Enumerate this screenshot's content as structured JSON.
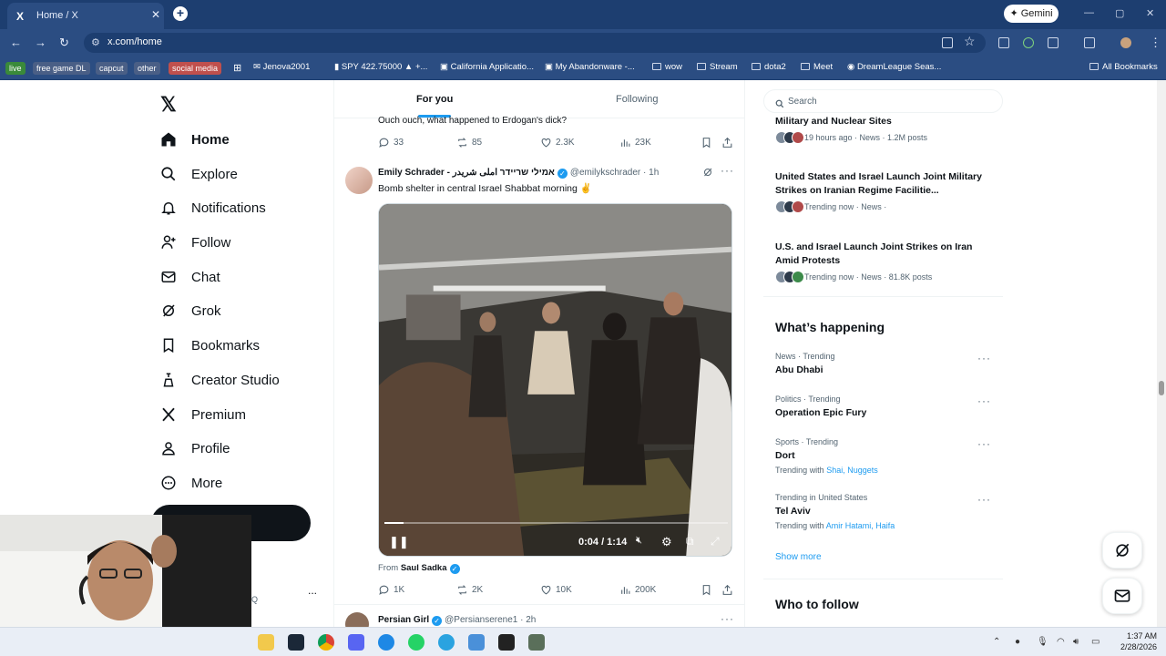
{
  "browser": {
    "tab_title": "Home / X",
    "tab_favicon": "X",
    "url": "x.com/home",
    "gemini_label": "Gemini",
    "bookmarks": [
      "live",
      "free game DL",
      "capcut",
      "other",
      "social media",
      "Jenova2001",
      "SPY 422.75000 ▲ +...",
      "California Applicatio...",
      "My Abandonware -...",
      "wow",
      "Stream",
      "dota2",
      "Meet",
      "DreamLeague Seas...",
      "All Bookmarks"
    ],
    "pill_colors": {
      "live": "#3a8a3a",
      "social": "#c0504d",
      "other_pills": "#4a5f86"
    }
  },
  "nav": {
    "items": [
      {
        "label": "Home",
        "icon": "home-icon"
      },
      {
        "label": "Explore",
        "icon": "search-icon"
      },
      {
        "label": "Notifications",
        "icon": "bell-icon"
      },
      {
        "label": "Follow",
        "icon": "person-add-icon"
      },
      {
        "label": "Chat",
        "icon": "envelope-icon"
      },
      {
        "label": "Grok",
        "icon": "grok-icon"
      },
      {
        "label": "Bookmarks",
        "icon": "bookmark-icon"
      },
      {
        "label": "Creator Studio",
        "icon": "creator-studio-icon"
      },
      {
        "label": "Premium",
        "icon": "x-logo-icon"
      },
      {
        "label": "Profile",
        "icon": "person-icon"
      },
      {
        "label": "More",
        "icon": "more-circle-icon"
      }
    ],
    "side_dots": "...",
    "side_letter": "Q"
  },
  "feed": {
    "tabs": [
      "For you",
      "Following"
    ],
    "prev_post_text": "Ouch ouch, what happened to Erdogan's dick?",
    "prev_actions": {
      "replies": "33",
      "reposts": "85",
      "likes": "2.3K",
      "views": "23K"
    },
    "post": {
      "author": "Emily Schrader - אמילי שריידר املی شریدر",
      "handle": "@emilykschrader",
      "time": "· 1h",
      "text": "Bomb shelter in central Israel Shabbat morning ✌️",
      "video_time": "0:04 / 1:14",
      "video_progress": 0.055,
      "from_label": "From",
      "from_name": "Saul Sadka",
      "actions": {
        "replies": "1K",
        "reposts": "2K",
        "likes": "10K",
        "views": "200K"
      }
    },
    "next_post": {
      "author": "Persian Girl",
      "handle": "@Persianserene1",
      "time": "· 2h"
    }
  },
  "sidebar": {
    "search_placeholder": "Search",
    "news": [
      {
        "title": "Military and Nuclear Sites",
        "meta": "19 hours ago · News · 1.2M posts"
      },
      {
        "title": "United States and Israel Launch Joint Military Strikes on Iranian Regime Facilitie...",
        "meta": "Trending now · News ·"
      },
      {
        "title": "U.S. and Israel Launch Joint Strikes on Iran Amid Protests",
        "meta": "Trending now · News · 81.8K posts"
      }
    ],
    "whats_happening": "What’s happening",
    "trends": [
      {
        "category": "News · Trending",
        "name": "Abu Dhabi",
        "with_label": "",
        "with": ""
      },
      {
        "category": "Politics · Trending",
        "name": "Operation Epic Fury",
        "with_label": "",
        "with": ""
      },
      {
        "category": "Sports · Trending",
        "name": "Dort",
        "with_label": "Trending with",
        "with": "Shai, Nuggets"
      },
      {
        "category": "Trending in United States",
        "name": "Tel Aviv",
        "with_label": "Trending with",
        "with": "Amir Hatami, Haifa"
      }
    ],
    "show_more": "Show more",
    "who_to_follow": "Who to follow"
  },
  "taskbar": {
    "time": "1:37 AM",
    "date": "2/28/2026"
  }
}
